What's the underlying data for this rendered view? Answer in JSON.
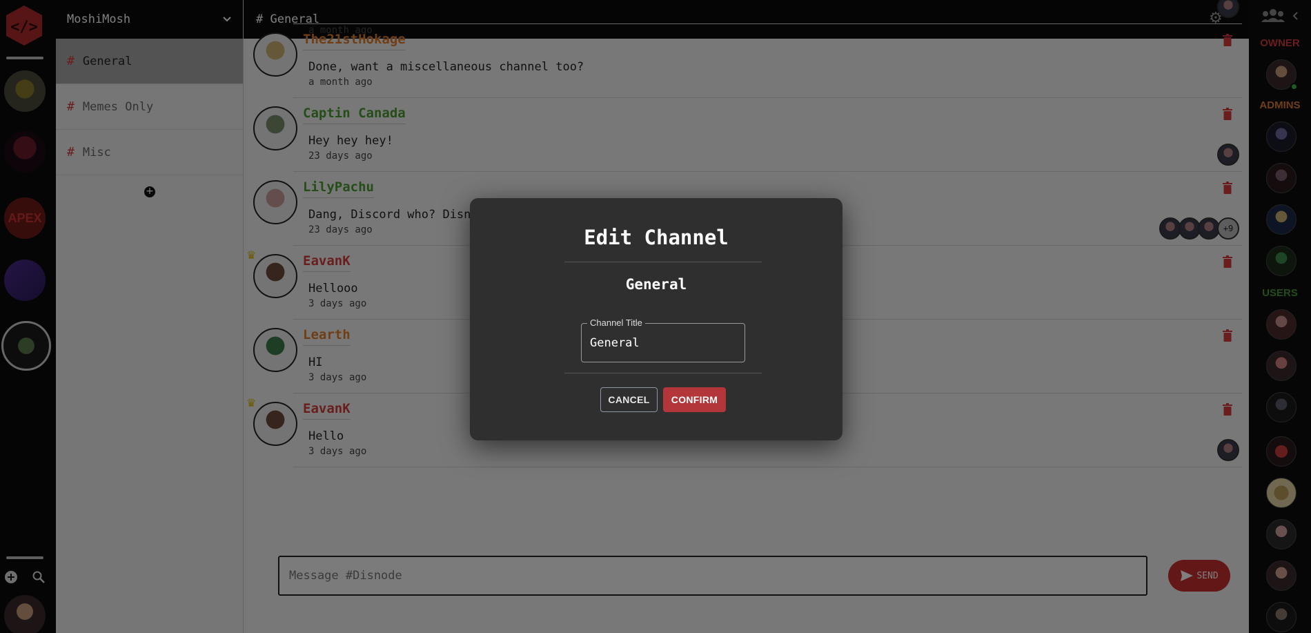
{
  "server": {
    "name": "MoshiMosh"
  },
  "channels": [
    {
      "name": "General",
      "active": true
    },
    {
      "name": "Memes Only",
      "active": false
    },
    {
      "name": "Misc",
      "active": false
    }
  ],
  "topbar": {
    "title": "# General"
  },
  "messages": [
    {
      "author": "",
      "text": "",
      "time": "a month ago",
      "color": "#7a7a7a",
      "crown": false,
      "readers": 1
    },
    {
      "author": "The21stHokage",
      "text": "Done, want a miscellaneous channel too?",
      "time": "a month ago",
      "color": "#e07d2a",
      "crown": false,
      "readers": 0
    },
    {
      "author": "Captin Canada",
      "text": "Hey hey hey!",
      "time": "23 days ago",
      "color": "#4a9a2e",
      "crown": false,
      "readers": 1
    },
    {
      "author": "LilyPachu",
      "text": "Dang, Discord who? Disno",
      "time": "23 days ago",
      "color": "#4a9a2e",
      "crown": false,
      "readers": 3,
      "more": "+9"
    },
    {
      "author": "EavanK",
      "text": "Hellooo",
      "time": "3 days ago",
      "color": "#d23a3a",
      "crown": true,
      "readers": 0
    },
    {
      "author": "Learth",
      "text": "HI",
      "time": "3 days ago",
      "color": "#e07d2a",
      "crown": false,
      "readers": 0
    },
    {
      "author": "EavanK",
      "text": "Hello",
      "time": "3 days ago",
      "color": "#d23a3a",
      "crown": true,
      "readers": 1
    }
  ],
  "composer": {
    "placeholder": "Message #Disnode",
    "send_label": "SEND"
  },
  "members": {
    "owner_label": "OWNER",
    "admins_label": "ADMINS",
    "users_label": "USERS",
    "owner_color": "#d23a3a",
    "admins_color": "#e07d2a",
    "users_color": "#4a9a2e"
  },
  "modal": {
    "title": "Edit Channel",
    "subtitle": "General",
    "field_label": "Channel Title",
    "field_value": "General",
    "cancel_label": "CANCEL",
    "confirm_label": "CONFIRM"
  },
  "icons": {
    "logo": "code-logo-icon",
    "add": "plus-circle-icon",
    "search": "search-icon",
    "dropdown": "chevron-down-icon",
    "gear": "gear-icon",
    "trash": "trash-icon",
    "send": "send-icon",
    "members": "people-icon",
    "collapse": "chevron-left-icon"
  }
}
